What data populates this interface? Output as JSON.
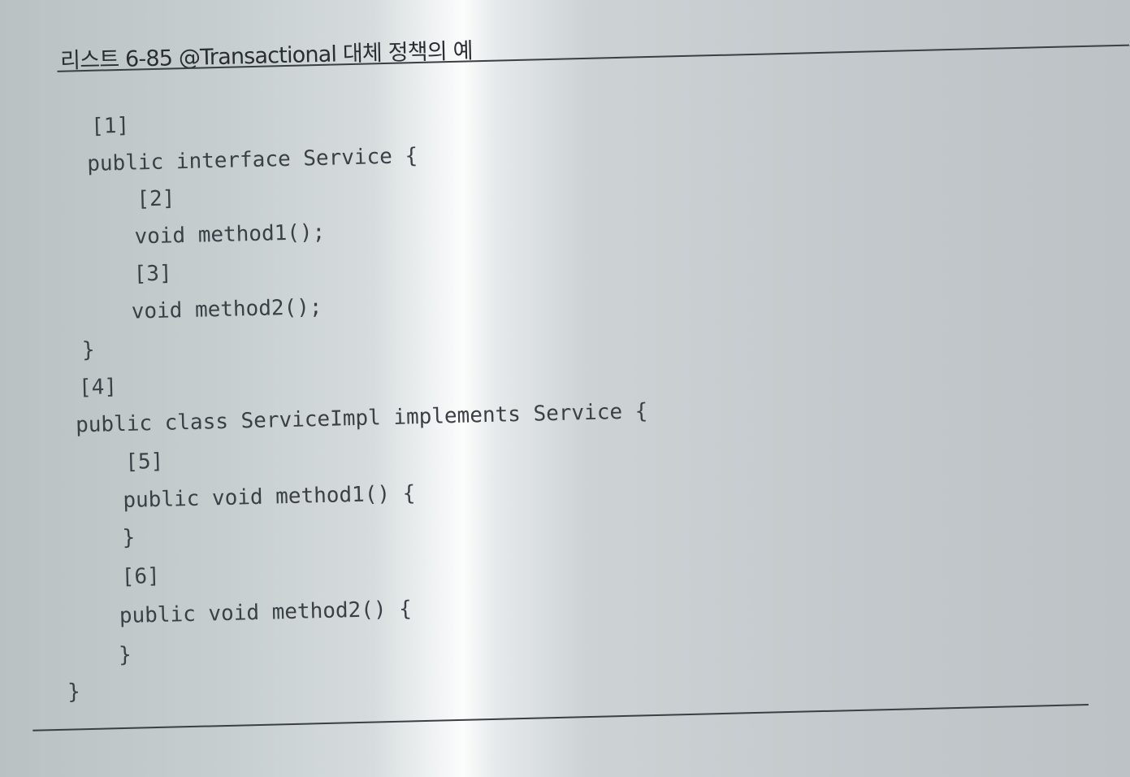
{
  "listing": {
    "title": "리스트 6-85 @Transactional 대체 정책의 예",
    "code_lines": [
      "[1]",
      "public interface Service {",
      "[2]",
      "void method1();",
      "[3]",
      "void method2();",
      "}",
      "[4]",
      "public class ServiceImpl implements Service {",
      "[5]",
      "public void method1() {",
      "}",
      "[6]",
      "public void method2() {",
      "}",
      "}"
    ]
  }
}
